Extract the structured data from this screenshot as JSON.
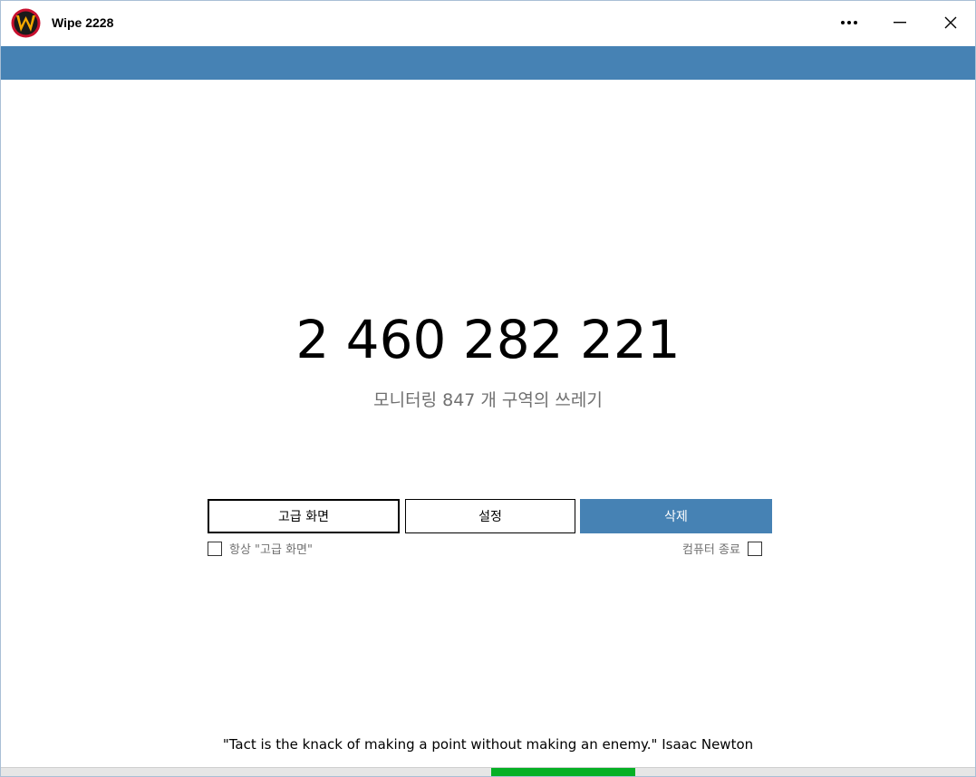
{
  "window": {
    "title": "Wipe 2228"
  },
  "titlebar": {
    "more_icon": "more-horizontal-icon",
    "minimize_icon": "minimize-icon",
    "close_icon": "close-icon"
  },
  "colors": {
    "accent": "#4682b4",
    "progress": "#06b025",
    "subtitle_text": "#707070"
  },
  "main": {
    "count": "2 460 282 221",
    "subtitle": "모니터링 847 개 구역의 쓰레기"
  },
  "buttons": {
    "advanced": "고급 화면",
    "settings": "설정",
    "delete": "삭제"
  },
  "options": {
    "always_advanced_label": "항상 \"고급 화면\"",
    "always_advanced_checked": false,
    "shutdown_label": "컴퓨터 종료",
    "shutdown_checked": false
  },
  "footer": {
    "quote": "\"Tact is the knack of making a point without making an enemy.\" Isaac Newton"
  },
  "status": {
    "activity_indicator": "marquee-progress"
  }
}
